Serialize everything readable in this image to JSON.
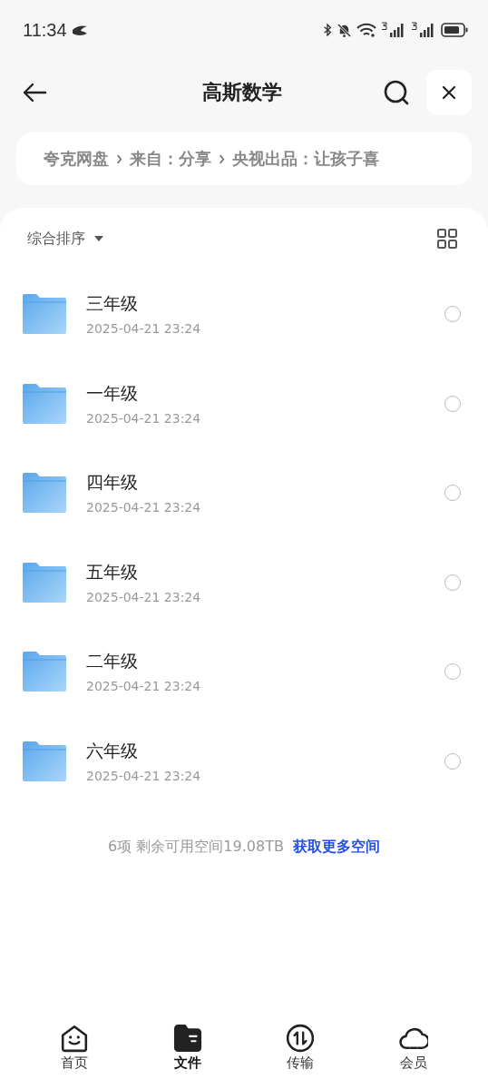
{
  "status_bar": {
    "time": "11:34"
  },
  "header": {
    "title": "高斯数学"
  },
  "breadcrumb": [
    "夸克网盘",
    "来自：分享",
    "央视出品：让孩子喜"
  ],
  "sort": {
    "label": "综合排序"
  },
  "files": [
    {
      "name": "三年级",
      "date": "2025-04-21 23:24",
      "selected": false
    },
    {
      "name": "一年级",
      "date": "2025-04-21 23:24",
      "selected": false
    },
    {
      "name": "四年级",
      "date": "2025-04-21 23:24",
      "selected": false
    },
    {
      "name": "五年级",
      "date": "2025-04-21 23:24",
      "selected": false
    },
    {
      "name": "二年级",
      "date": "2025-04-21 23:24",
      "selected": false
    },
    {
      "name": "六年级",
      "date": "2025-04-21 23:24",
      "selected": false
    }
  ],
  "summary": {
    "text": "6项 剩余可用空间19.08TB",
    "link": "获取更多空间"
  },
  "tabs": [
    {
      "label": "首页",
      "kind": "home",
      "selected": false
    },
    {
      "label": "文件",
      "kind": "files",
      "selected": true
    },
    {
      "label": "传输",
      "kind": "transfer",
      "selected": false
    },
    {
      "label": "会员",
      "kind": "cloud",
      "selected": false
    }
  ]
}
